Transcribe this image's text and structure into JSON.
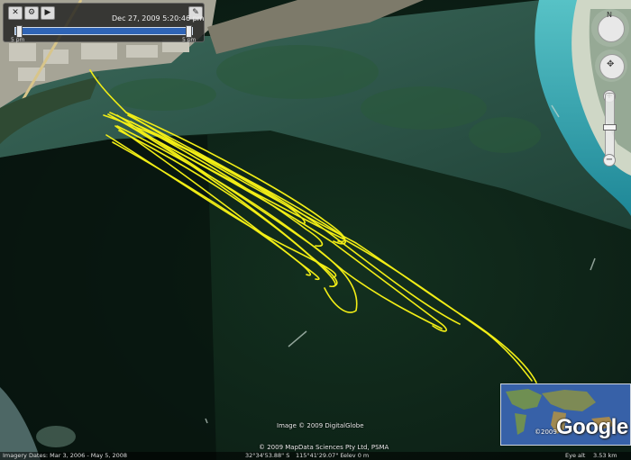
{
  "time_slider": {
    "date_time": "Dec 27, 2009   5:20:46 pm",
    "left_tick": "5 pm",
    "right_tick": "5 pm",
    "range_start_fraction": 0.02,
    "range_end_fraction": 0.98
  },
  "credits": {
    "imagery": "Image © 2009 DigitalGlobe",
    "data": "© 2009 MapData Sciences Pty Ltd, PSMA"
  },
  "overview_map": {
    "logo_text": "Google",
    "copyright": "©2009"
  },
  "status_bar": {
    "imagery_dates": "Imagery Dates: Mar 3, 2006 - May 5, 2008",
    "coordinates": "32°34'53.88\" S",
    "longitude": "115°41'29.07\" E",
    "elevation": "elev   0 m",
    "eye_alt_label": "Eye alt",
    "eye_alt_value": "3.53 km"
  },
  "colors": {
    "track": "#f2ee16",
    "water_deep": "#0d2218",
    "water_shallow": "#2e5a4e",
    "channel": "#2aa6b4"
  }
}
